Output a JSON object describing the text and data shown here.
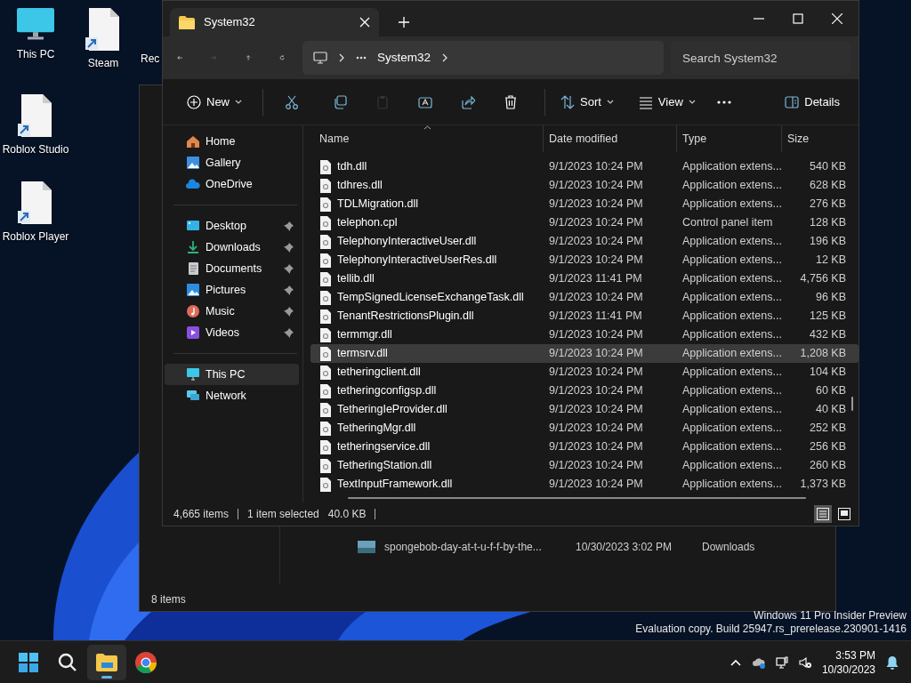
{
  "desktop_icons": [
    {
      "label": "This PC",
      "kind": "pc"
    },
    {
      "label": "Steam",
      "kind": "shortcut"
    },
    {
      "label": "Rec",
      "kind": "hidden"
    },
    {
      "label": "Roblox Studio",
      "kind": "shortcut"
    },
    {
      "label": "Roblox Player",
      "kind": "shortcut"
    }
  ],
  "back_window": {
    "rows": [
      {
        "name": "spongebob-day-at-t-u-f-f-by-the...",
        "date": "10/30/2023 3:02 PM",
        "location": "Downloads"
      }
    ],
    "status": "8 items"
  },
  "window": {
    "tab_title": "System32",
    "nav_buttons": [
      {
        "kind": "back",
        "disabled": false
      },
      {
        "kind": "forward",
        "disabled": true
      },
      {
        "kind": "up",
        "disabled": false
      },
      {
        "kind": "refresh",
        "disabled": false
      }
    ],
    "breadcrumb": [
      "System32"
    ],
    "search": {
      "placeholder": "Search System32"
    },
    "toolbar": [
      {
        "kind": "new",
        "label": "New",
        "disabled": false
      },
      {
        "kind": "cut",
        "disabled": false
      },
      {
        "kind": "copy",
        "disabled": false
      },
      {
        "kind": "paste",
        "disabled": true
      },
      {
        "kind": "rename",
        "disabled": false
      },
      {
        "kind": "share",
        "disabled": false
      },
      {
        "kind": "delete",
        "disabled": false
      },
      {
        "kind": "sort",
        "label": "Sort",
        "disabled": false
      },
      {
        "kind": "view",
        "label": "View",
        "disabled": false
      },
      {
        "kind": "more",
        "disabled": false
      },
      {
        "kind": "details",
        "label": "Details",
        "disabled": false
      }
    ],
    "sidebar": {
      "groups": [
        [
          {
            "label": "Home",
            "kind": "home",
            "pinned": false,
            "selected": false
          },
          {
            "label": "Gallery",
            "kind": "gallery",
            "pinned": false,
            "selected": false
          },
          {
            "label": "OneDrive",
            "kind": "cloud",
            "pinned": false,
            "selected": false
          }
        ],
        [
          {
            "label": "Desktop",
            "kind": "desktop",
            "pinned": true,
            "selected": false
          },
          {
            "label": "Downloads",
            "kind": "downloads",
            "pinned": true,
            "selected": false
          },
          {
            "label": "Documents",
            "kind": "documents",
            "pinned": true,
            "selected": false
          },
          {
            "label": "Pictures",
            "kind": "pictures",
            "pinned": true,
            "selected": false
          },
          {
            "label": "Music",
            "kind": "music",
            "pinned": true,
            "selected": false
          },
          {
            "label": "Videos",
            "kind": "videos",
            "pinned": true,
            "selected": false
          }
        ],
        [
          {
            "label": "This PC",
            "kind": "pc",
            "pinned": false,
            "selected": true
          },
          {
            "label": "Network",
            "kind": "network",
            "pinned": false,
            "selected": false
          }
        ]
      ]
    },
    "columns": [
      {
        "label": "Name",
        "sorted": true
      },
      {
        "label": "Date modified",
        "sorted": false
      },
      {
        "label": "Type",
        "sorted": false
      },
      {
        "label": "Size",
        "sorted": false
      }
    ],
    "rows": [
      {
        "name": "tdh.dll",
        "date": "9/1/2023 10:24 PM",
        "type": "Application extens...",
        "size": "540 KB",
        "selected": false
      },
      {
        "name": "tdhres.dll",
        "date": "9/1/2023 10:24 PM",
        "type": "Application extens...",
        "size": "628 KB",
        "selected": false
      },
      {
        "name": "TDLMigration.dll",
        "date": "9/1/2023 10:24 PM",
        "type": "Application extens...",
        "size": "276 KB",
        "selected": false
      },
      {
        "name": "telephon.cpl",
        "date": "9/1/2023 10:24 PM",
        "type": "Control panel item",
        "size": "128 KB",
        "selected": false
      },
      {
        "name": "TelephonyInteractiveUser.dll",
        "date": "9/1/2023 10:24 PM",
        "type": "Application extens...",
        "size": "196 KB",
        "selected": false
      },
      {
        "name": "TelephonyInteractiveUserRes.dll",
        "date": "9/1/2023 10:24 PM",
        "type": "Application extens...",
        "size": "12 KB",
        "selected": false
      },
      {
        "name": "tellib.dll",
        "date": "9/1/2023 11:41 PM",
        "type": "Application extens...",
        "size": "4,756 KB",
        "selected": false
      },
      {
        "name": "TempSignedLicenseExchangeTask.dll",
        "date": "9/1/2023 10:24 PM",
        "type": "Application extens...",
        "size": "96 KB",
        "selected": false
      },
      {
        "name": "TenantRestrictionsPlugin.dll",
        "date": "9/1/2023 11:41 PM",
        "type": "Application extens...",
        "size": "125 KB",
        "selected": false
      },
      {
        "name": "termmgr.dll",
        "date": "9/1/2023 10:24 PM",
        "type": "Application extens...",
        "size": "432 KB",
        "selected": false
      },
      {
        "name": "termsrv.dll",
        "date": "9/1/2023 10:24 PM",
        "type": "Application extens...",
        "size": "1,208 KB",
        "selected": true
      },
      {
        "name": "tetheringclient.dll",
        "date": "9/1/2023 10:24 PM",
        "type": "Application extens...",
        "size": "104 KB",
        "selected": false
      },
      {
        "name": "tetheringconfigsp.dll",
        "date": "9/1/2023 10:24 PM",
        "type": "Application extens...",
        "size": "60 KB",
        "selected": false
      },
      {
        "name": "TetheringIeProvider.dll",
        "date": "9/1/2023 10:24 PM",
        "type": "Application extens...",
        "size": "40 KB",
        "selected": false
      },
      {
        "name": "TetheringMgr.dll",
        "date": "9/1/2023 10:24 PM",
        "type": "Application extens...",
        "size": "252 KB",
        "selected": false
      },
      {
        "name": "tetheringservice.dll",
        "date": "9/1/2023 10:24 PM",
        "type": "Application extens...",
        "size": "256 KB",
        "selected": false
      },
      {
        "name": "TetheringStation.dll",
        "date": "9/1/2023 10:24 PM",
        "type": "Application extens...",
        "size": "260 KB",
        "selected": false
      },
      {
        "name": "TextInputFramework.dll",
        "date": "9/1/2023 10:24 PM",
        "type": "Application extens...",
        "size": "1,373 KB",
        "selected": false
      }
    ],
    "status": {
      "count": "4,665 items",
      "selection": "1 item selected",
      "selection_size": "40.0 KB"
    },
    "view_modes": [
      {
        "kind": "details",
        "selected": true
      },
      {
        "kind": "tiles",
        "selected": false
      }
    ]
  },
  "watermark": [
    "Windows 11 Pro Insider Preview",
    "Evaluation copy. Build 25947.rs_prerelease.230901-1416"
  ],
  "taskbar": {
    "apps": [
      {
        "kind": "start",
        "active": false
      },
      {
        "kind": "search",
        "active": false
      },
      {
        "kind": "explorer",
        "active": true
      },
      {
        "kind": "chrome",
        "active": false
      }
    ],
    "tray": [
      {
        "kind": "chevron"
      },
      {
        "kind": "cloud"
      },
      {
        "kind": "network"
      },
      {
        "kind": "volume-muted"
      }
    ],
    "time": "3:53 PM",
    "date": "10/30/2023"
  }
}
